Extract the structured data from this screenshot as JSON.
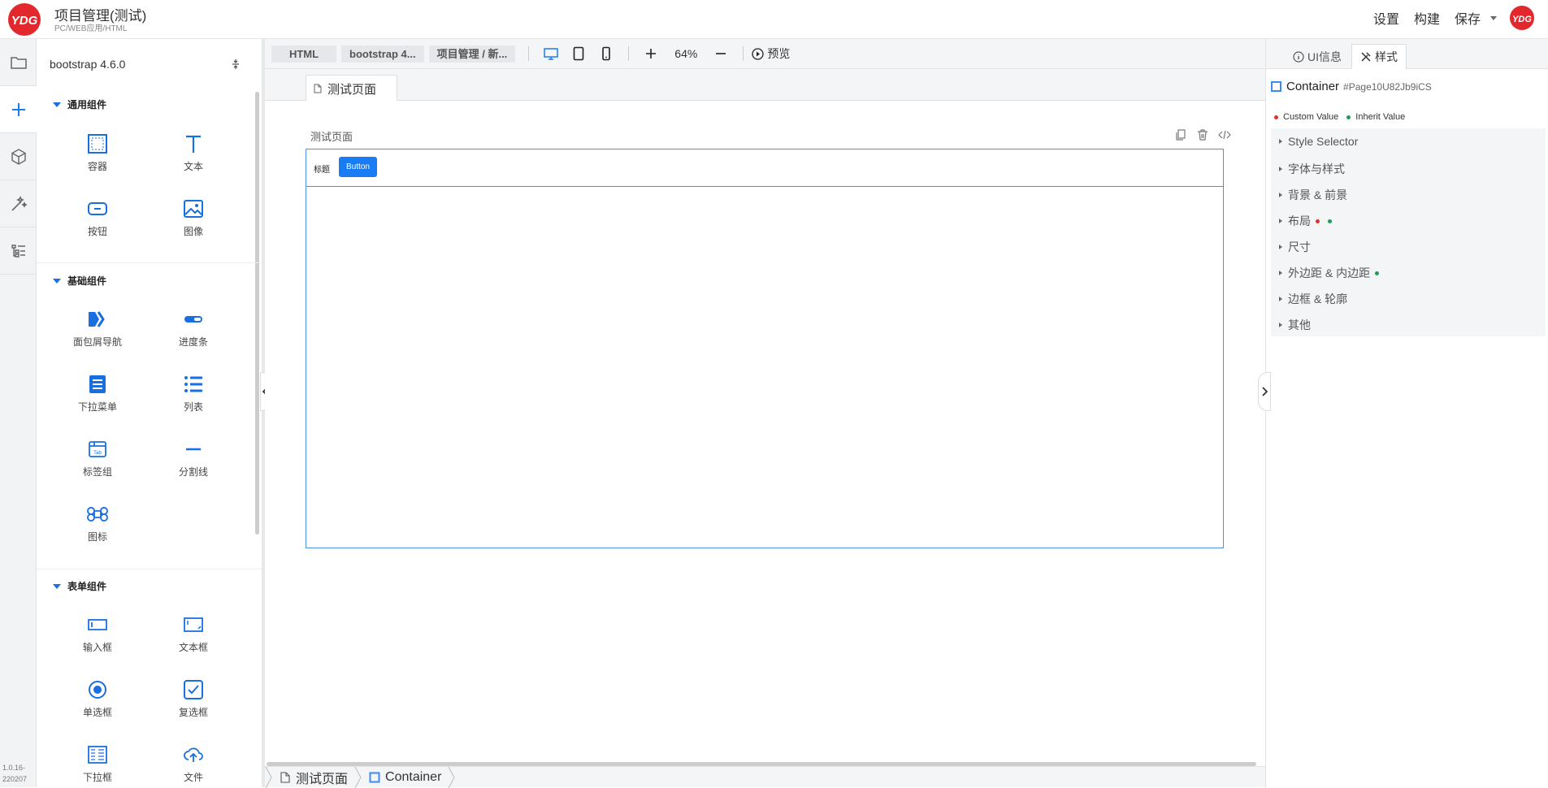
{
  "app": {
    "title": "项目管理(测试)",
    "subtitle": "PC/WEB应用/HTML",
    "top_actions": {
      "settings": "设置",
      "build": "构建",
      "save": "保存"
    },
    "version_line1": "1.0.16-",
    "version_line2": "220207"
  },
  "components": {
    "library": "bootstrap 4.6.0",
    "groups": [
      {
        "title": "通用组件",
        "items": [
          "容器",
          "文本",
          "按钮",
          "图像"
        ]
      },
      {
        "title": "基础组件",
        "items": [
          "面包屑导航",
          "进度条",
          "下拉菜单",
          "列表",
          "标签组",
          "分割线",
          "图标"
        ]
      },
      {
        "title": "表单组件",
        "items": [
          "输入框",
          "文本框",
          "单选框",
          "复选框",
          "下拉框",
          "文件"
        ]
      }
    ]
  },
  "toolbar": {
    "crumbs": [
      "HTML",
      "bootstrap 4...",
      "项目管理 / 新..."
    ],
    "zoom": "64%",
    "preview": "预览"
  },
  "editor": {
    "tab": "测试页面",
    "page_label": "测试页面",
    "nav_title": "标题",
    "nav_button": "Button"
  },
  "statusbar": {
    "page": "测试页面",
    "element": "Container"
  },
  "inspector": {
    "tabs": {
      "ui_info": "UI信息",
      "style": "样式"
    },
    "selected_name": "Container",
    "selected_id": "#Page10U82Jb9iCS",
    "legend": {
      "custom": "Custom Value",
      "inherit": "Inherit Value"
    },
    "sections": [
      "Style Selector",
      "字体与样式",
      "背景 & 前景",
      "布局",
      "尺寸",
      "外边距 & 内边距",
      "边框 & 轮廓",
      "其他"
    ]
  },
  "colors": {
    "brand": "#e3282d",
    "accent": "#1a7cf4",
    "custom_dot": "#e03131",
    "inherit_dot": "#1f9d55"
  }
}
